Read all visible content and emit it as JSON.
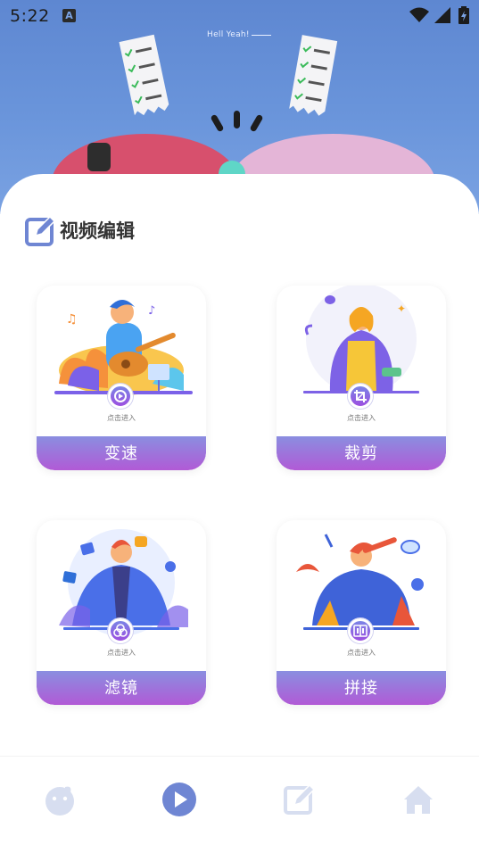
{
  "status_bar": {
    "time": "5:22",
    "indicator": "A"
  },
  "banner": {
    "tagline": "Hell Yeah!"
  },
  "section": {
    "title": "视频编辑"
  },
  "cards": [
    {
      "label": "变速",
      "hint": "点击进入",
      "icon": "speed-icon"
    },
    {
      "label": "裁剪",
      "hint": "点击进入",
      "icon": "crop-icon"
    },
    {
      "label": "滤镜",
      "hint": "点击进入",
      "icon": "filter-icon"
    },
    {
      "label": "拼接",
      "hint": "点击进入",
      "icon": "splice-icon"
    }
  ],
  "bottom_nav": [
    {
      "icon": "mascot-icon",
      "active": false
    },
    {
      "icon": "play-icon",
      "active": true
    },
    {
      "icon": "edit-icon",
      "active": false
    },
    {
      "icon": "home-icon",
      "active": false
    }
  ],
  "colors": {
    "accent_start": "#8a8ee0",
    "accent_end": "#b15ad6",
    "nav_active": "#6f86d3",
    "nav_inactive": "#d7def0",
    "banner": "#6a95db"
  }
}
